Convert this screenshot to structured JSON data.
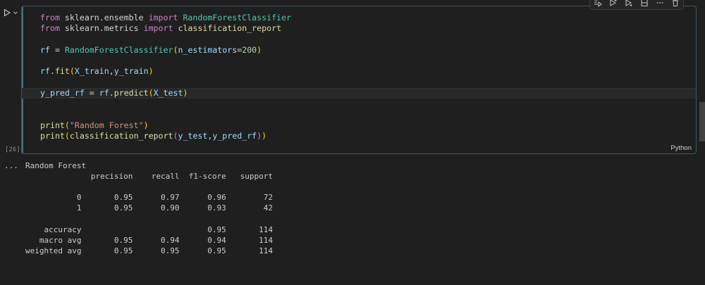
{
  "cell": {
    "execution_count": "[26]",
    "language": "Python",
    "code_lines": [
      [
        {
          "t": "from",
          "c": "kw"
        },
        {
          "t": " sklearn.ensemble ",
          "c": "pl"
        },
        {
          "t": "import",
          "c": "kw"
        },
        {
          "t": " ",
          "c": "pl"
        },
        {
          "t": "RandomForestClassifier",
          "c": "cls"
        }
      ],
      [
        {
          "t": "from",
          "c": "kw"
        },
        {
          "t": " sklearn.metrics ",
          "c": "pl"
        },
        {
          "t": "import",
          "c": "kw"
        },
        {
          "t": " ",
          "c": "pl"
        },
        {
          "t": "classification_report",
          "c": "fn"
        }
      ],
      [],
      [
        {
          "t": "rf",
          "c": "var"
        },
        {
          "t": " = ",
          "c": "pl"
        },
        {
          "t": "RandomForestClassifier",
          "c": "cls"
        },
        {
          "t": "(",
          "c": "br1"
        },
        {
          "t": "n_estimators",
          "c": "var"
        },
        {
          "t": "=",
          "c": "pl"
        },
        {
          "t": "200",
          "c": "num"
        },
        {
          "t": ")",
          "c": "br1"
        }
      ],
      [],
      [
        {
          "t": "rf",
          "c": "var"
        },
        {
          "t": ".",
          "c": "pl"
        },
        {
          "t": "fit",
          "c": "fn"
        },
        {
          "t": "(",
          "c": "br1"
        },
        {
          "t": "X_train",
          "c": "var"
        },
        {
          "t": ",",
          "c": "pl"
        },
        {
          "t": "y_train",
          "c": "var"
        },
        {
          "t": ")",
          "c": "br1"
        }
      ],
      [],
      [
        {
          "t": "y_pred_rf",
          "c": "var"
        },
        {
          "t": " = ",
          "c": "pl"
        },
        {
          "t": "rf",
          "c": "var"
        },
        {
          "t": ".",
          "c": "pl"
        },
        {
          "t": "predict",
          "c": "fn"
        },
        {
          "t": "(",
          "c": "br1"
        },
        {
          "t": "X_test",
          "c": "var"
        },
        {
          "t": ")",
          "c": "br1"
        }
      ],
      [],
      [],
      [
        {
          "t": "print",
          "c": "fn"
        },
        {
          "t": "(",
          "c": "br1"
        },
        {
          "t": "\"Random Forest\"",
          "c": "str"
        },
        {
          "t": ")",
          "c": "br1"
        }
      ],
      [
        {
          "t": "print",
          "c": "fn"
        },
        {
          "t": "(",
          "c": "br1"
        },
        {
          "t": "classification_report",
          "c": "fn"
        },
        {
          "t": "(",
          "c": "br2"
        },
        {
          "t": "y_test",
          "c": "var"
        },
        {
          "t": ",",
          "c": "pl"
        },
        {
          "t": "y_pred_rf",
          "c": "var"
        },
        {
          "t": ")",
          "c": "br2"
        },
        {
          "t": ")",
          "c": "br1"
        }
      ]
    ],
    "current_line_index": 7
  },
  "output": {
    "dots": "...",
    "lines": [
      "Random Forest",
      "              precision    recall  f1-score   support",
      "",
      "           0       0.95      0.97      0.96        72",
      "           1       0.95      0.90      0.93        42",
      "",
      "    accuracy                           0.95       114",
      "   macro avg       0.95      0.94      0.94       114",
      "weighted avg       0.95      0.95      0.95       114"
    ]
  },
  "toolbar": {
    "icons": [
      "run-by-line-icon",
      "execute-above-icon",
      "execute-below-icon",
      "split-cell-icon",
      "more-actions-icon",
      "delete-icon"
    ]
  },
  "colors": {
    "background": "#1f1f1f",
    "cell_border": "#3a5a66",
    "keyword": "#c586c0",
    "class": "#4ec9b0",
    "function": "#dcdcaa",
    "variable": "#9cdcfe",
    "number": "#b5cea8",
    "string": "#ce9178"
  }
}
